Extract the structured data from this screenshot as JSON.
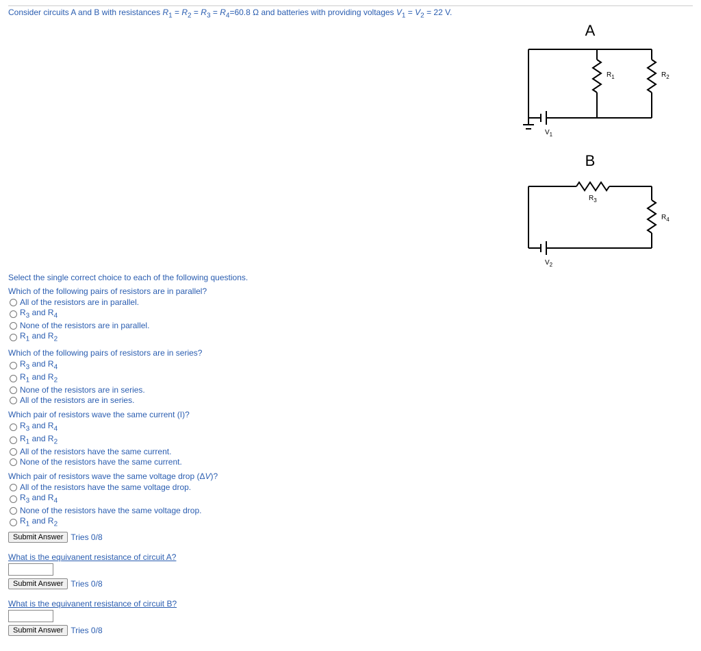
{
  "intro_html": "Consider circuits A and B with resistances <i>R</i><sub>1</sub> = <i>R</i><sub>2</sub> = <i>R</i><sub>3</sub> = <i>R</i><sub>4</sub>=60.8 Ω and batteries with providing voltages <i>V</i><sub>1</sub> = <i>V</i><sub>2</sub> = 22 V.",
  "circuitA": {
    "label": "A",
    "R1": "R",
    "R1sub": "1",
    "R2": "R",
    "R2sub": "2",
    "V": "V",
    "Vsub": "1"
  },
  "circuitB": {
    "label": "B",
    "R3": "R",
    "R3sub": "3",
    "R4": "R",
    "R4sub": "4",
    "V": "V",
    "Vsub": "2"
  },
  "section_intro": "Select the single correct choice to each of the following questions.",
  "q1": {
    "text": "Which of the following pairs of resistors are in parallel?",
    "opts": [
      "All of the resistors are in parallel.",
      "R<sub>3</sub> and R<sub>4</sub>",
      "None of the resistors are in parallel.",
      "R<sub>1</sub> and R<sub>2</sub>"
    ]
  },
  "q2": {
    "text": "Which of the following pairs of resistors are in series?",
    "opts": [
      "R<sub>3</sub> and R<sub>4</sub>",
      "R<sub>1</sub> and R<sub>2</sub>",
      "None of the resistors are in series.",
      "All of the resistors are in series."
    ]
  },
  "q3": {
    "text": "Which pair of resistors wave the same current (I)?",
    "opts": [
      "R<sub>3</sub> and R<sub>4</sub>",
      "R<sub>1</sub> and R<sub>2</sub>",
      "All of the resistors have the same current.",
      "None of the resistors have the same current."
    ]
  },
  "q4": {
    "text_html": "Which pair of resistors wave the same voltage drop (Δ<i>V</i>)?",
    "opts": [
      "All of the resistors have the same voltage drop.",
      "R<sub>3</sub> and R<sub>4</sub>",
      "None of the resistors have the same voltage drop.",
      "R<sub>1</sub> and R<sub>2</sub>"
    ]
  },
  "submit_label": "Submit Answer",
  "tries": "Tries 0/8",
  "free1": "What is the equivanent resistance of circuit A?",
  "free2": "What is the equivanent resistance of circuit B?"
}
